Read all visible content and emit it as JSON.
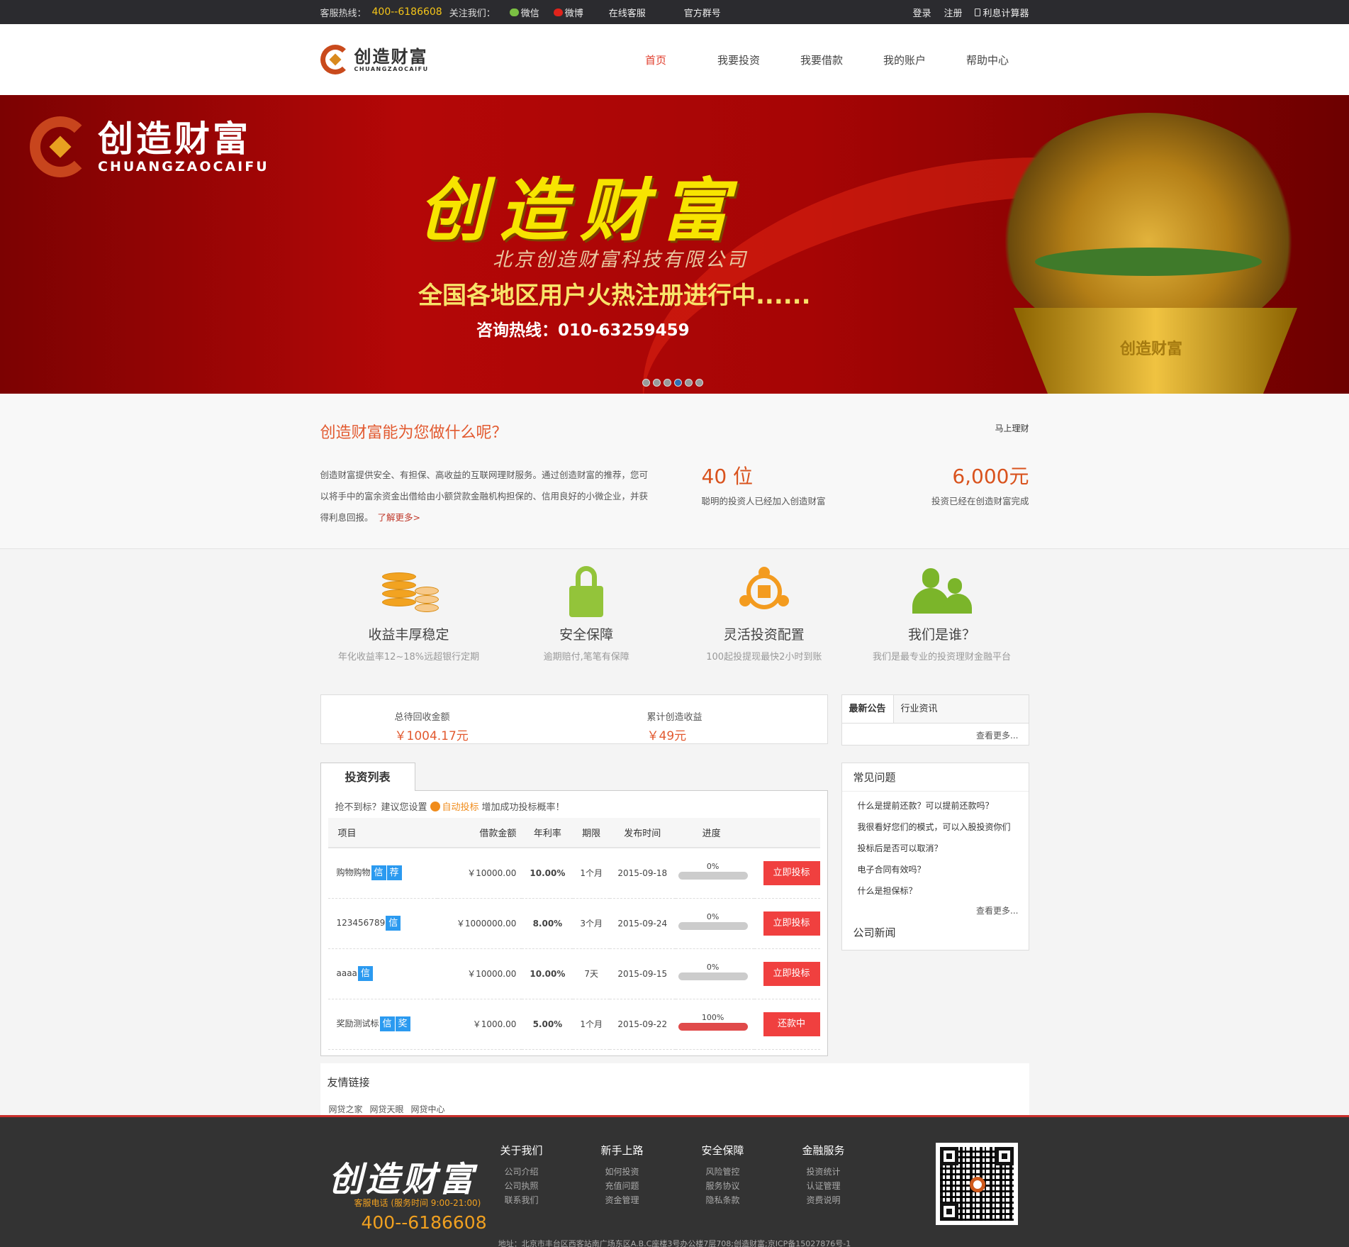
{
  "topbar": {
    "hotline_label": "客服热线：",
    "hotline": "400--6186608",
    "follow_label": "关注我们：",
    "wechat": "微信",
    "weibo": "微博",
    "online_service": "在线客服",
    "official_group": "官方群号",
    "login": "登录",
    "register": "注册",
    "calculator": "利息计算器"
  },
  "header": {
    "logo_cn": "创造财富",
    "logo_en": "CHUANGZAOCAIFU",
    "nav": [
      "首页",
      "我要投资",
      "我要借款",
      "我的账户",
      "帮助中心"
    ],
    "active_nav": "首页"
  },
  "banner": {
    "logo_cn": "创造财富",
    "logo_en": "CHUANGZAOCAIFU",
    "title": "创造财富",
    "company": "北京创造财富科技有限公司",
    "slogan": "全国各地区用户火热注册进行中......",
    "phone": "咨询热线：010-63259459",
    "stand_text": "创造财富",
    "slide_count": 6,
    "active_slide": 4
  },
  "intro": {
    "title": "创造财富能为您做什么呢？",
    "link": "马上理财",
    "text": "创造财富提供安全、有担保、高收益的互联网理财服务。通过创造财富的推荐，您可以将手中的富余资金出借给由小额贷款金融机构担保的、信用良好的小微企业，并获得利息回报。",
    "more": "了解更多>",
    "stat1_num": "40 位",
    "stat1_label": "聪明的投资人已经加入创造财富",
    "stat2_num": "6,000元",
    "stat2_label": "投资已经在创造财富完成"
  },
  "features": [
    {
      "title": "收益丰厚稳定",
      "desc": "年化收益率12~18%远超银行定期",
      "icon": "coins-icon"
    },
    {
      "title": "安全保障",
      "desc": "逾期赔付,笔笔有保障",
      "icon": "lock-icon"
    },
    {
      "title": "灵活投资配置",
      "desc": "100起投提现最快2小时到账",
      "icon": "network-icon"
    },
    {
      "title": "我们是谁？",
      "desc": "我们是最专业的投资理财金融平台",
      "icon": "people-icon"
    }
  ],
  "summary": {
    "pending_label": "总待回收金额",
    "pending_value": "￥1004.17元",
    "earned_label": "累计创造收益",
    "earned_value": "￥49元"
  },
  "notice": {
    "tab_active": "最新公告",
    "tab_other": "行业资讯",
    "more": "查看更多..."
  },
  "invest": {
    "tab": "投资列表",
    "tip_before": "抢不到标？建议您设置",
    "tip_auto": "自动投标",
    "tip_after": "增加成功投标概率！",
    "headers": [
      "项目",
      "借款金额",
      "年利率",
      "期限",
      "发布时间",
      "进度"
    ],
    "rows": [
      {
        "name": "购物购物",
        "tags": [
          "信",
          "荐"
        ],
        "amount": "￥10000.00",
        "rate": "10.00%",
        "term": "1个月",
        "date": "2015-09-18",
        "progress_label": "0%",
        "progress": 0,
        "action": "立即投标"
      },
      {
        "name": "123456789",
        "tags": [
          "信"
        ],
        "amount": "￥1000000.00",
        "rate": "8.00%",
        "term": "3个月",
        "date": "2015-09-24",
        "progress_label": "0%",
        "progress": 0,
        "action": "立即投标"
      },
      {
        "name": "aaaa",
        "tags": [
          "信"
        ],
        "amount": "￥10000.00",
        "rate": "10.00%",
        "term": "7天",
        "date": "2015-09-15",
        "progress_label": "0%",
        "progress": 0,
        "action": "立即投标"
      },
      {
        "name": "奖励测试标",
        "tags": [
          "信",
          "奖"
        ],
        "amount": "￥1000.00",
        "rate": "5.00%",
        "term": "1个月",
        "date": "2015-09-22",
        "progress_label": "100%",
        "progress": 100,
        "action": "还款中"
      }
    ]
  },
  "faq": {
    "title": "常见问题",
    "items": [
      "什么是提前还款？可以提前还款吗？",
      "我很看好您们的模式，可以入股投资你们",
      "投标后是否可以取消？",
      "电子合同有效吗？",
      "什么是担保标？"
    ],
    "more": "查看更多...",
    "news_title": "公司新闻"
  },
  "friends": {
    "title": "友情链接",
    "links": [
      "网贷之家",
      "网贷天眼",
      "网贷中心"
    ]
  },
  "footer": {
    "logo": "创造财富",
    "service": "客服电话 (服务时间 9:00-21:00)",
    "phone": "400--6186608",
    "cols": [
      {
        "title": "关于我们",
        "items": [
          "公司介绍",
          "公司执照",
          "联系我们"
        ]
      },
      {
        "title": "新手上路",
        "items": [
          "如何投资",
          "充值问题",
          "资金管理"
        ]
      },
      {
        "title": "安全保障",
        "items": [
          "风险管控",
          "服务协议",
          "隐私条款"
        ]
      },
      {
        "title": "金融服务",
        "items": [
          "投资统计",
          "认证管理",
          "资费说明"
        ]
      }
    ],
    "address": "地址：北京市丰台区西客站南广场东区A.B.C座楼3号办公楼7层708;创造财富;京ICP备15027876号-1"
  }
}
